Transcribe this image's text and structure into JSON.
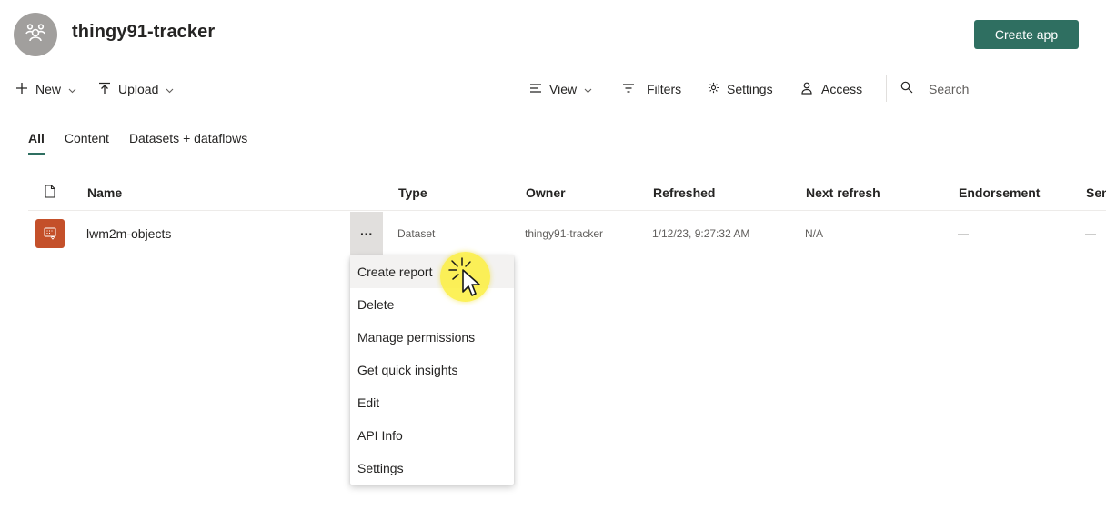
{
  "workspace": {
    "title": "thingy91-tracker",
    "create_app_label": "Create app"
  },
  "toolbar": {
    "new_label": "New",
    "upload_label": "Upload",
    "view_label": "View",
    "filters_label": "Filters",
    "settings_label": "Settings",
    "access_label": "Access",
    "search_placeholder": "Search"
  },
  "tabs": [
    {
      "label": "All",
      "active": true
    },
    {
      "label": "Content",
      "active": false
    },
    {
      "label": "Datasets + dataflows",
      "active": false
    }
  ],
  "table": {
    "columns": [
      "Name",
      "Type",
      "Owner",
      "Refreshed",
      "Next refresh",
      "Endorsement",
      "Sen"
    ],
    "rows": [
      {
        "name": "lwm2m-objects",
        "type": "Dataset",
        "owner": "thingy91-tracker",
        "refreshed": "1/12/23, 9:27:32 AM",
        "next_refresh": "N/A",
        "endorsement": "—",
        "sensitivity": "—",
        "more_label": "···"
      }
    ]
  },
  "context_menu": {
    "items": [
      "Create report",
      "Delete",
      "Manage permissions",
      "Get quick insights",
      "Edit",
      "API Info",
      "Settings"
    ]
  },
  "colors": {
    "brand": "#2f6f61",
    "dataset_icon_bg": "#c4502a",
    "click_highlight": "#fcee3c"
  }
}
